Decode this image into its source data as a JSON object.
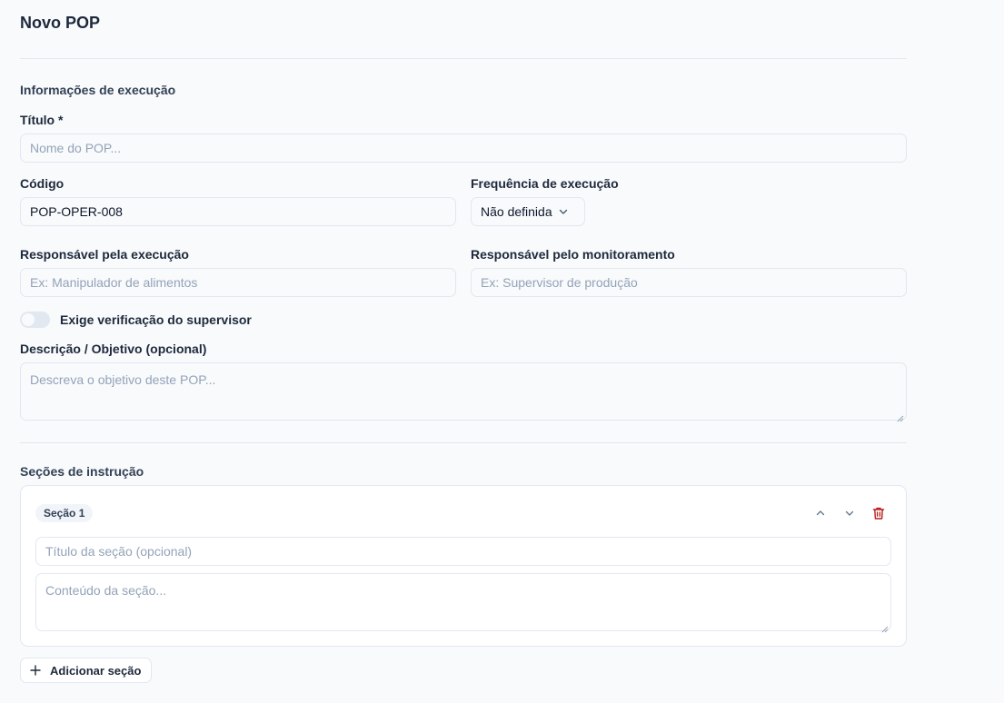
{
  "page": {
    "title": "Novo POP"
  },
  "execution": {
    "heading": "Informações de execução",
    "title_label": "Título *",
    "title_placeholder": "Nome do POP...",
    "code_label": "Código",
    "code_value": "POP-OPER-008",
    "frequency_label": "Frequência de execução",
    "frequency_value": "Não definida",
    "exec_resp_label": "Responsável pela execução",
    "exec_resp_placeholder": "Ex: Manipulador de alimentos",
    "monitor_resp_label": "Responsável pelo monitoramento",
    "monitor_resp_placeholder": "Ex: Supervisor de produção",
    "supervisor_toggle_label": "Exige verificação do supervisor",
    "supervisor_toggle_on": false,
    "description_label": "Descrição / Objetivo (opcional)",
    "description_placeholder": "Descreva o objetivo deste POP..."
  },
  "instructions": {
    "heading": "Seções de instrução",
    "sections": [
      {
        "badge": "Seção 1",
        "title_placeholder": "Título da seção (opcional)",
        "content_placeholder": "Conteúdo da seção..."
      }
    ],
    "add_section_label": "Adicionar seção"
  },
  "icons": {
    "move_up": "chevron-up-icon",
    "move_down": "chevron-down-icon",
    "delete": "trash-icon",
    "add": "plus-icon",
    "select_caret": "chevron-down-icon"
  },
  "colors": {
    "delete_icon": "#b91c1c",
    "border": "#e2e8f0",
    "background": "#f8fafc"
  }
}
